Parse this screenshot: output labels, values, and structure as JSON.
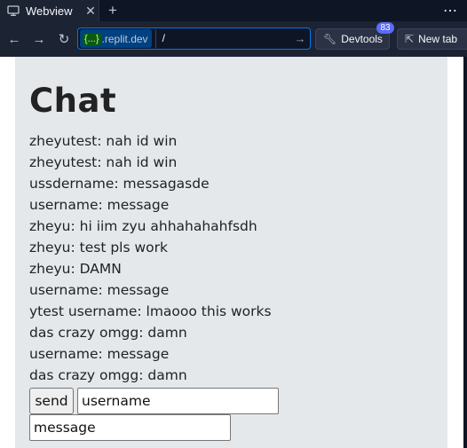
{
  "browser": {
    "tab_title": "Webview",
    "domain_badge": "{...}",
    "domain_text": ".replit.dev",
    "path": "/",
    "devtools_label": "Devtools",
    "devtools_count": "83",
    "new_tab_label": "New tab"
  },
  "page": {
    "title": "Chat",
    "messages": [
      "zheyutest: nah id win",
      "zheyutest: nah id win",
      "ussdername: messagasde",
      "username: message",
      "zheyu: hi iim zyu ahhahahahfsdh",
      "zheyu: test pls work",
      "zheyu: DAMN",
      "username: message",
      "ytest username: lmaooo this works",
      "das crazy omgg: damn",
      "username: message",
      "das crazy omgg: damn"
    ],
    "send_label": "send",
    "username_placeholder": "username",
    "message_placeholder": "message"
  },
  "colors": {
    "chrome_bg": "#0e1525",
    "toolbar_bg": "#1c2333",
    "accent": "#0079f2",
    "card_bg": "#e5e8eb"
  }
}
